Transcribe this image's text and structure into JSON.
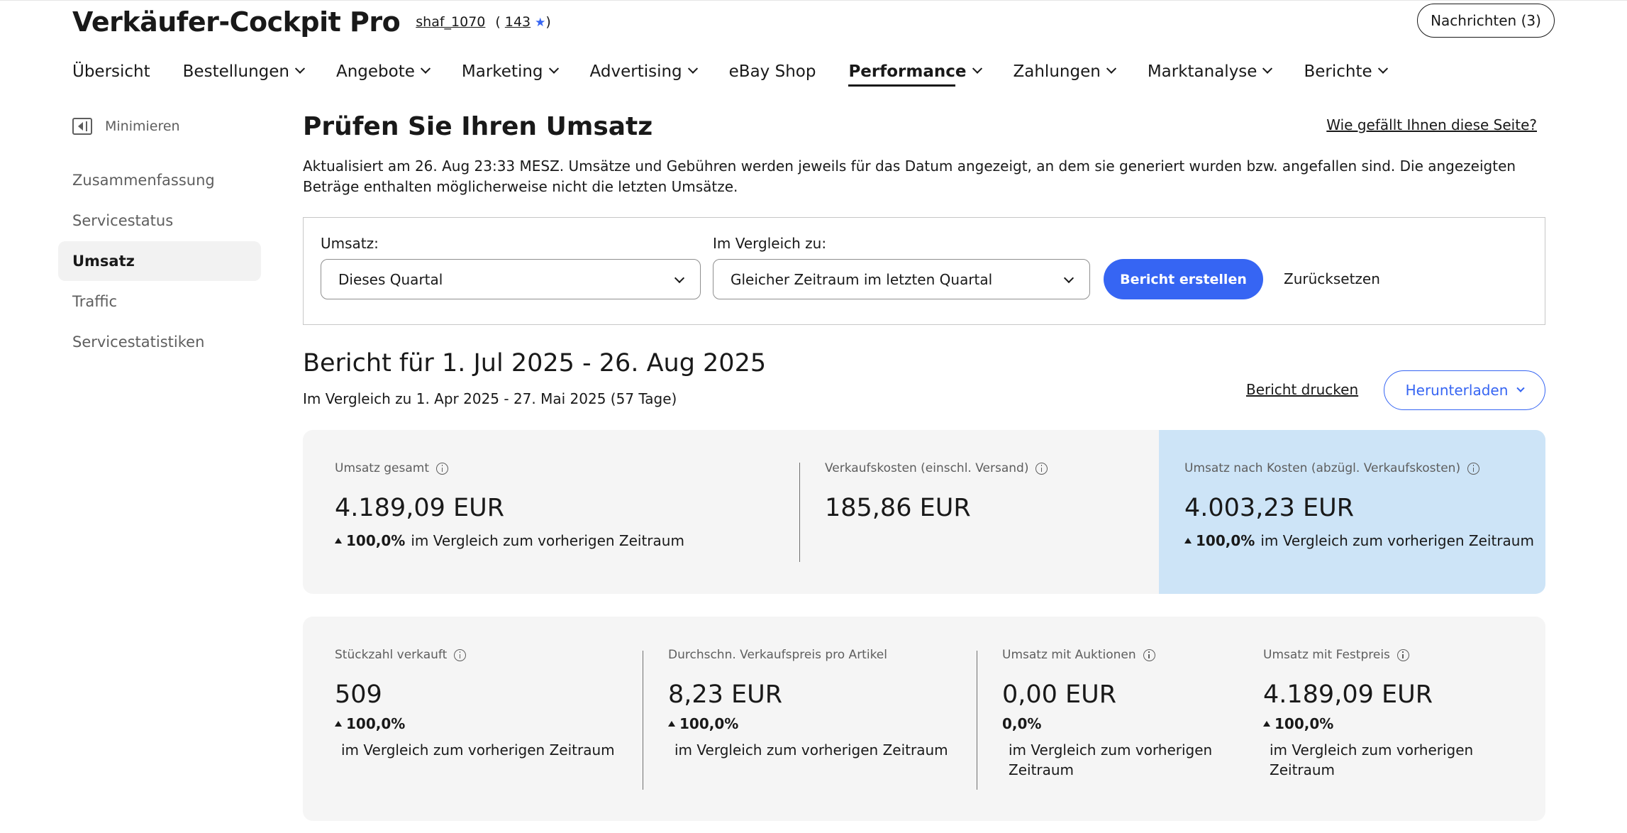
{
  "header": {
    "title": "Verkäufer-Cockpit Pro",
    "username": "shaf_1070",
    "feedback_open": "(",
    "feedback_score": "143",
    "feedback_star": "★",
    "feedback_close": ")",
    "messages_label": "Nachrichten (3)"
  },
  "nav": {
    "items": [
      {
        "label": "Übersicht"
      },
      {
        "label": "Bestellungen"
      },
      {
        "label": "Angebote"
      },
      {
        "label": "Marketing"
      },
      {
        "label": "Advertising"
      },
      {
        "label": "eBay Shop"
      },
      {
        "label": "Performance"
      },
      {
        "label": "Zahlungen"
      },
      {
        "label": "Marktanalyse"
      },
      {
        "label": "Berichte"
      }
    ]
  },
  "sidebar": {
    "minimize_label": "Minimieren",
    "items": [
      {
        "label": "Zusammenfassung"
      },
      {
        "label": "Servicestatus"
      },
      {
        "label": "Umsatz"
      },
      {
        "label": "Traffic"
      },
      {
        "label": "Servicestatistiken"
      }
    ]
  },
  "main": {
    "title": "Prüfen Sie Ihren Umsatz",
    "feedback_link": "Wie gefällt Ihnen diese Seite?",
    "updated_text": "Aktualisiert am 26. Aug 23:33 MESZ. Umsätze und Gebühren werden jeweils für das Datum angezeigt, an dem sie generiert wurden bzw. angefallen sind. Die angezeigten Beträge enthalten möglicherweise nicht die letzten Umsätze.",
    "filter": {
      "sales_label": "Umsatz:",
      "sales_value": "Dieses Quartal",
      "compare_label": "Im Vergleich zu:",
      "compare_value": "Gleicher Zeitraum im letzten Quartal",
      "create_button": "Bericht erstellen",
      "reset_link": "Zurücksetzen"
    },
    "report": {
      "title": "Bericht für 1. Jul 2025 - 26. Aug 2025",
      "subtitle": "Im Vergleich zu 1. Apr 2025 - 27. Mai 2025 (57 Tage)",
      "print_link": "Bericht drucken",
      "download_button": "Herunterladen"
    },
    "summary_metrics": [
      {
        "label": "Umsatz gesamt",
        "value": "4.189,09 EUR",
        "change": "100,0%",
        "change_text": "im Vergleich zum vorherigen Zeitraum"
      },
      {
        "label": "Verkaufskosten (einschl. Versand)",
        "value": "185,86 EUR"
      },
      {
        "label": "Umsatz nach Kosten (abzügl. Verkaufskosten)",
        "value": "4.003,23 EUR",
        "change": "100,0%",
        "change_text": "im Vergleich zum vorherigen Zeitraum"
      }
    ],
    "detail_metrics": [
      {
        "label": "Stückzahl verkauft",
        "value": "509",
        "change": "100,0%",
        "change_text": "im Vergleich zum vorherigen Zeitraum"
      },
      {
        "label": "Durchschn. Verkaufspreis pro Artikel",
        "value": "8,23 EUR",
        "change": "100,0%",
        "change_text": "im Vergleich zum vorherigen Zeitraum"
      },
      {
        "label": "Umsatz mit Auktionen",
        "value": "0,00 EUR",
        "change": "0,0%",
        "change_text": "im Vergleich zum vorherigen Zeitraum"
      },
      {
        "label": "Umsatz mit Festpreis",
        "value": "4.189,09 EUR",
        "change": "100,0%",
        "change_text": "im Vergleich zum vorherigen Zeitraum"
      }
    ]
  },
  "colors": {
    "accent": "#3665f3",
    "highlight_card": "#cde4f7",
    "card_background": "#f5f5f5"
  }
}
